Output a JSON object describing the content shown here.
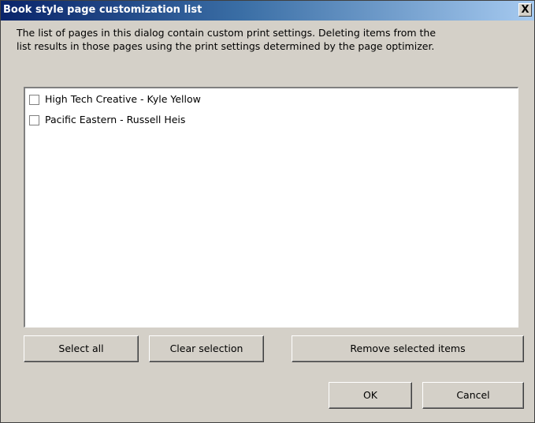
{
  "window": {
    "title": "Book style page customization list",
    "close_label": "X"
  },
  "description": "The list of pages in this dialog contain custom print settings. Deleting items from the\nlist results in those pages using the print settings determined by the page optimizer.",
  "list": {
    "items": [
      {
        "label": "High Tech Creative - Kyle Yellow",
        "checked": false
      },
      {
        "label": "Pacific Eastern - Russell Heis",
        "checked": false
      }
    ]
  },
  "buttons": {
    "select_all": "Select all",
    "clear_selection": "Clear selection",
    "remove_selected": "Remove selected items",
    "ok": "OK",
    "cancel": "Cancel"
  },
  "colors": {
    "title_gradient_start": "#0a246a",
    "title_gradient_end": "#a6caf0",
    "dialog_background": "#d4d0c8"
  }
}
